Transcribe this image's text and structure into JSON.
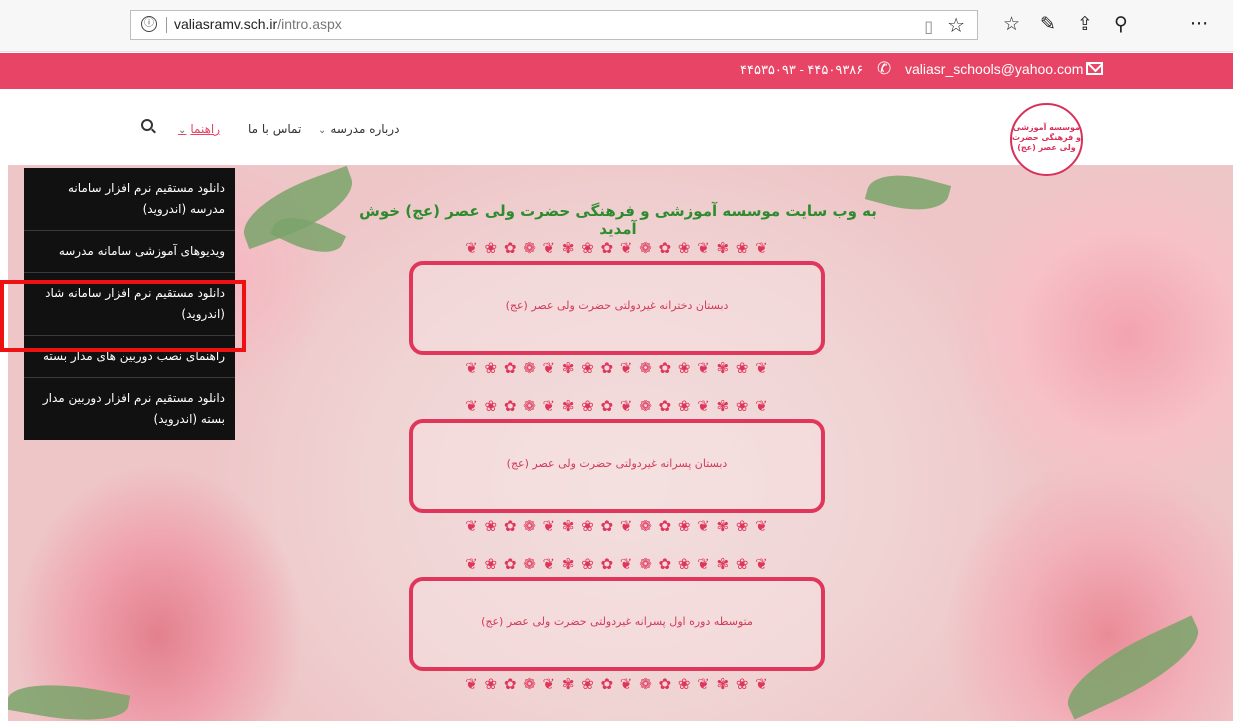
{
  "browser": {
    "url_domain": "valiasramv.sch.ir",
    "url_path": "/intro.aspx",
    "info_icon": "ⓘ",
    "icons": [
      "reading-view-icon",
      "favorite-star-icon",
      "favorites-list-icon",
      "pen-icon",
      "share-icon",
      "extensions-icon",
      "more-icon"
    ],
    "more_label": "···"
  },
  "topbar": {
    "phone": "۴۴۵۳۵۰۹۳ - ۴۴۵۰۹۳۸۶",
    "email": "valiasr_schools@yahoo.com",
    "color": "#e84466"
  },
  "nav": {
    "about": "درباره مدرسه",
    "contact": "تماس با ما",
    "guide": "راهنما",
    "logo_text": "موسسه آموزشی و فرهنگی حضرت ولی عصر (عج)"
  },
  "dropdown": {
    "items": [
      "دانلود مستقیم نرم افزار سامانه مدرسه (اندروید)",
      "ویدیوهای آموزشی سامانه مدرسه",
      "دانلود مستقیم نرم افزار سامانه شاد (اندروید)",
      "راهنمای نصب دوربین های مدار بسته",
      "دانلود مستقیم نرم افزار دوربین مدار بسته (اندروید)"
    ]
  },
  "hero": {
    "welcome": "به وب سایت موسسه آموزشی و فرهنگی حضرت ولی عصر (عج) خوش آمدید",
    "schools": [
      "دبستان دخترانه غیردولتی حضرت ولی عصر (عج)",
      "دبستان پسرانه غیردولتی حضرت ولی عصر (عج)",
      "متوسطه دوره اول پسرانه غیردولتی حضرت ولی عصر (عج)"
    ],
    "ornament": "❦ ❀ ✿ ❁ ❦ ✾ ❀ ✿ ❦ ❁ ✿ ❀ ❦ ✾ ❀ ❦"
  }
}
